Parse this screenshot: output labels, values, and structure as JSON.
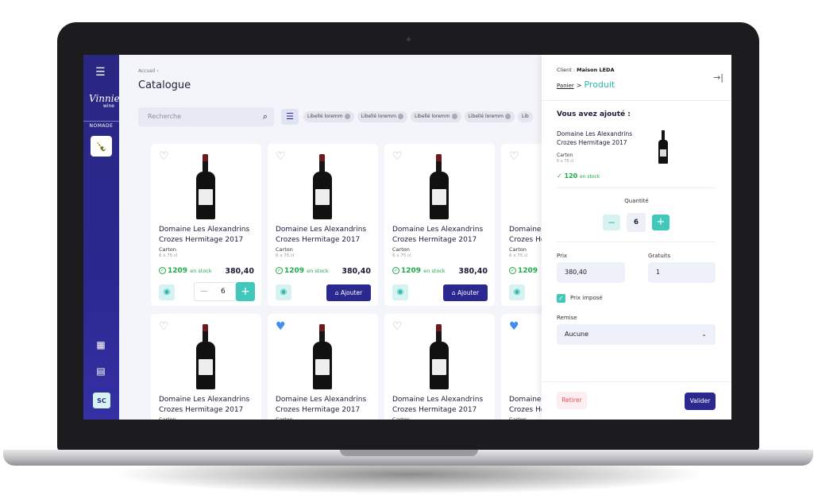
{
  "sidebar": {
    "brand_script": "Vinnie",
    "brand_suffix": "wine",
    "brand_label": "NOMADE",
    "avatar_initials": "SC",
    "icons": [
      "menu-icon",
      "calculator-icon",
      "document-icon"
    ]
  },
  "header": {
    "breadcrumb": "Accueil ›",
    "title": "Catalogue"
  },
  "search": {
    "placeholder": "Recherche"
  },
  "filters": {
    "chips": [
      "Libellé loremm",
      "Libellé loremm",
      "Libellé loremm",
      "Libellé loremm",
      "Lib"
    ]
  },
  "product": {
    "name_line1": "Domaine Les Alexandrins",
    "name_line2": "Crozes Hermitage 2017",
    "type": "Carton",
    "format": "6 x 75 cl",
    "stock_qty": "1209",
    "stock_unit": "en stock",
    "price": "380,40",
    "add_label": "Ajouter",
    "qty": "6"
  },
  "cards": [
    {
      "favorite": false,
      "has_qty": true
    },
    {
      "favorite": false,
      "has_qty": false
    },
    {
      "favorite": false,
      "has_qty": false
    },
    {
      "favorite": false,
      "has_qty": false
    },
    {
      "favorite": false
    },
    {
      "favorite": true
    },
    {
      "favorite": false
    },
    {
      "favorite": true
    }
  ],
  "panel": {
    "client_label": "Client :",
    "client_name": "Maison LEDA",
    "crumb_link": "Panier",
    "crumb_sep": ">",
    "crumb_current": "Produit",
    "added_title": "Vous avez ajouté :",
    "item_name_line1": "Domaine Les Alexandrins",
    "item_name_line2": "Crozes Hermitage 2017",
    "item_type": "Carton",
    "item_format": "6 x 75 cl",
    "item_stock_qty": "120",
    "item_stock_unit": "en stock",
    "quantity_label": "Quantité",
    "quantity_value": "6",
    "price_label": "Prix",
    "price_value": "380,40",
    "free_label": "Gratuits",
    "free_value": "1",
    "imposed_label": "Prix imposé",
    "imposed_checked": true,
    "discount_label": "Remise",
    "discount_value": "Aucune",
    "remove_label": "Retirer",
    "validate_label": "Valider"
  },
  "colors": {
    "sidebar": "#2b2890",
    "accent": "#42c8bb",
    "primary": "#2b2890",
    "stock": "#1faa48",
    "danger": "#e14f61",
    "heart_active": "#3d8ef0"
  }
}
